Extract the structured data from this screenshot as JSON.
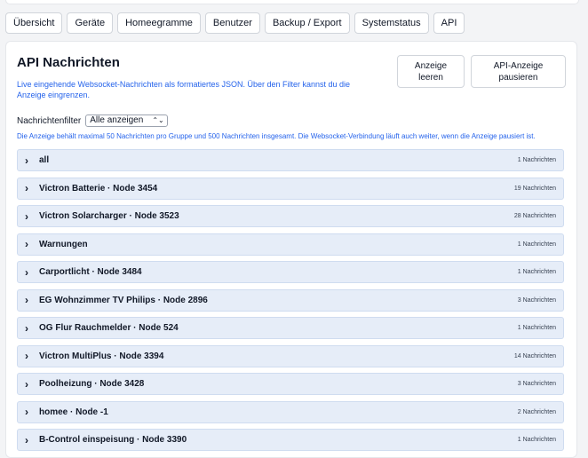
{
  "tabs": [
    "Übersicht",
    "Geräte",
    "Homeegramme",
    "Benutzer",
    "Backup / Export",
    "Systemstatus",
    "API"
  ],
  "panel": {
    "title": "API Nachrichten",
    "subtitle": "Live eingehende Websocket-Nachrichten als formatiertes JSON. Über den Filter kannst du die Anzeige eingrenzen.",
    "clear_button": "Anzeige leeren",
    "pause_button": "API-Anzeige pausieren",
    "filter_label": "Nachrichtenfilter",
    "filter_value": "Alle anzeigen",
    "info": "Die Anzeige behält maximal 50 Nachrichten pro Gruppe und 500 Nachrichten insgesamt. Die Websocket-Verbindung läuft auch weiter, wenn die Anzeige pausiert ist."
  },
  "groups": [
    {
      "name": "all",
      "count": "1 Nachrichten"
    },
    {
      "name": "Victron Batterie · Node 3454",
      "count": "19 Nachrichten"
    },
    {
      "name": "Victron Solarcharger · Node 3523",
      "count": "28 Nachrichten"
    },
    {
      "name": "Warnungen",
      "count": "1 Nachrichten"
    },
    {
      "name": "Carportlicht · Node 3484",
      "count": "1 Nachrichten"
    },
    {
      "name": "EG Wohnzimmer TV Philips · Node 2896",
      "count": "3 Nachrichten"
    },
    {
      "name": "OG Flur Rauchmelder · Node 524",
      "count": "1 Nachrichten"
    },
    {
      "name": "Victron MultiPlus · Node 3394",
      "count": "14 Nachrichten"
    },
    {
      "name": "Poolheizung · Node 3428",
      "count": "3 Nachrichten"
    },
    {
      "name": "homee · Node -1",
      "count": "2 Nachrichten"
    },
    {
      "name": "B-Control einspeisung · Node 3390",
      "count": "1 Nachrichten"
    }
  ],
  "icons": {
    "expand": "chevron-right-icon",
    "dropdown": "chevron-down-icon"
  }
}
